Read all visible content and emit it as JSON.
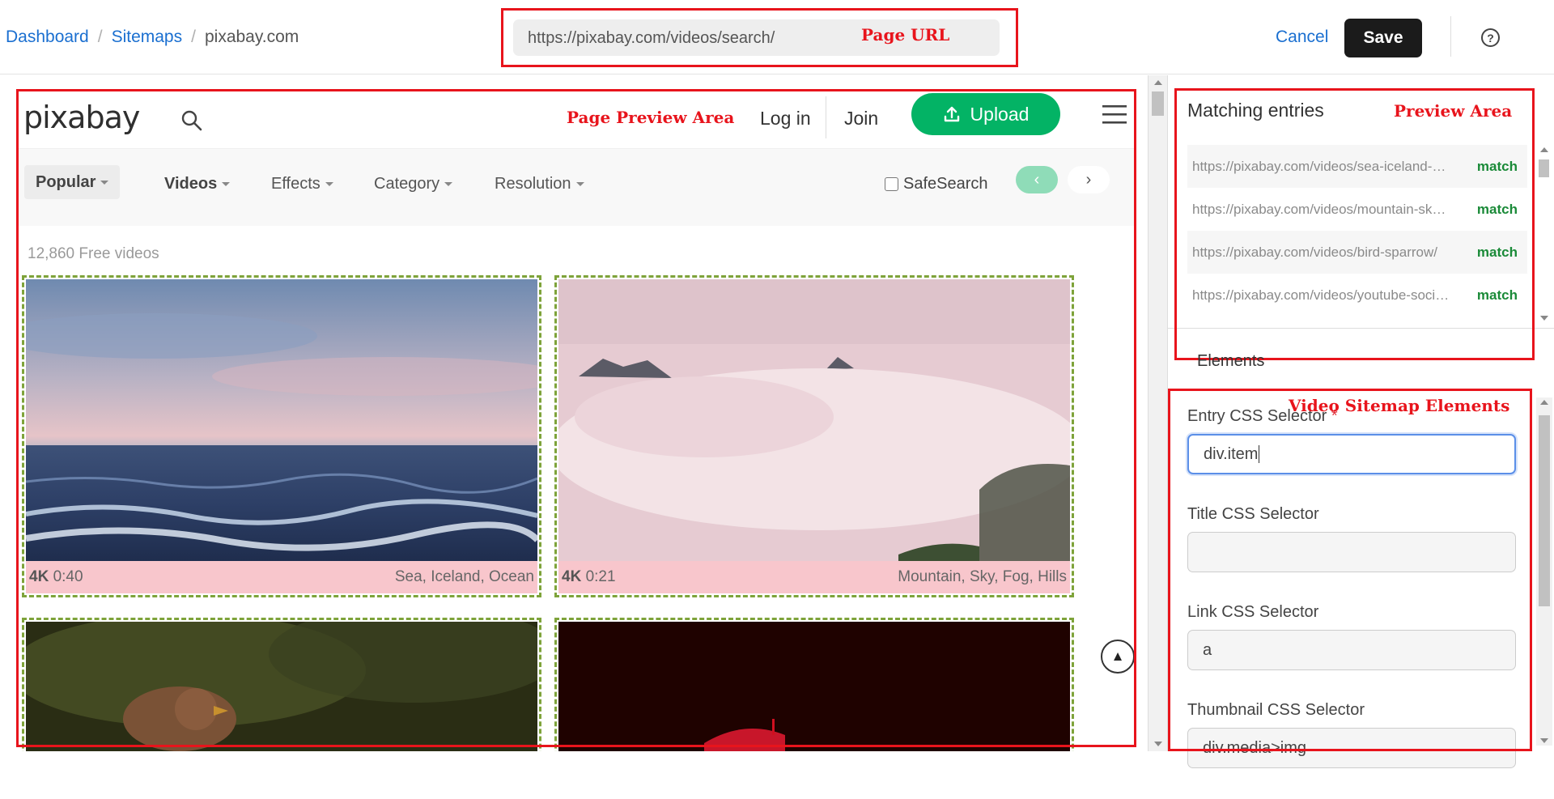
{
  "breadcrumb": {
    "dashboard": "Dashboard",
    "sitemaps": "Sitemaps",
    "current": "pixabay.com",
    "separator": "/"
  },
  "url_bar": {
    "value": "https://pixabay.com/videos/search/",
    "annotation": "Page URL"
  },
  "header_actions": {
    "cancel": "Cancel",
    "save": "Save",
    "help_icon": "question-circle-icon"
  },
  "preview": {
    "annotation": "Page Preview Area",
    "site": {
      "logo": "pixabay",
      "login": "Log in",
      "join": "Join",
      "upload": "Upload",
      "filters": [
        "Popular",
        "Videos",
        "Effects",
        "Category",
        "Resolution"
      ],
      "safesearch": "SafeSearch",
      "prev_icon": "‹",
      "next_icon": "›",
      "count": "12,860 Free videos",
      "cards": [
        {
          "quality": "4K",
          "duration": "0:40",
          "tags": "Sea, Iceland, Ocean"
        },
        {
          "quality": "4K",
          "duration": "0:21",
          "tags": "Mountain, Sky, Fog, Hills"
        }
      ],
      "scroll_top": "▲"
    }
  },
  "matching": {
    "title": "Matching entries",
    "annotation": "Preview Area",
    "entries": [
      {
        "url": "https://pixabay.com/videos/sea-iceland-ocean/",
        "status": "match"
      },
      {
        "url": "https://pixabay.com/videos/mountain-sky-fog-hills/",
        "status": "match"
      },
      {
        "url": "https://pixabay.com/videos/bird-sparrow/",
        "status": "match"
      },
      {
        "url": "https://pixabay.com/videos/youtube-social-media/",
        "status": "match"
      }
    ]
  },
  "elements": {
    "label": "Elements",
    "annotation": "Video Sitemap Elements",
    "fields": [
      {
        "label": "Entry CSS Selector",
        "required": "*",
        "value": "div.item"
      },
      {
        "label": "Title CSS Selector",
        "value": ""
      },
      {
        "label": "Link CSS Selector",
        "value": "a"
      },
      {
        "label": "Thumbnail CSS Selector",
        "value": "div.media>img"
      }
    ]
  },
  "colors": {
    "annotation_red": "#e8141c",
    "upload_green": "#03b365",
    "link_blue": "#1a6fd0",
    "match_green": "#1a8a38"
  }
}
